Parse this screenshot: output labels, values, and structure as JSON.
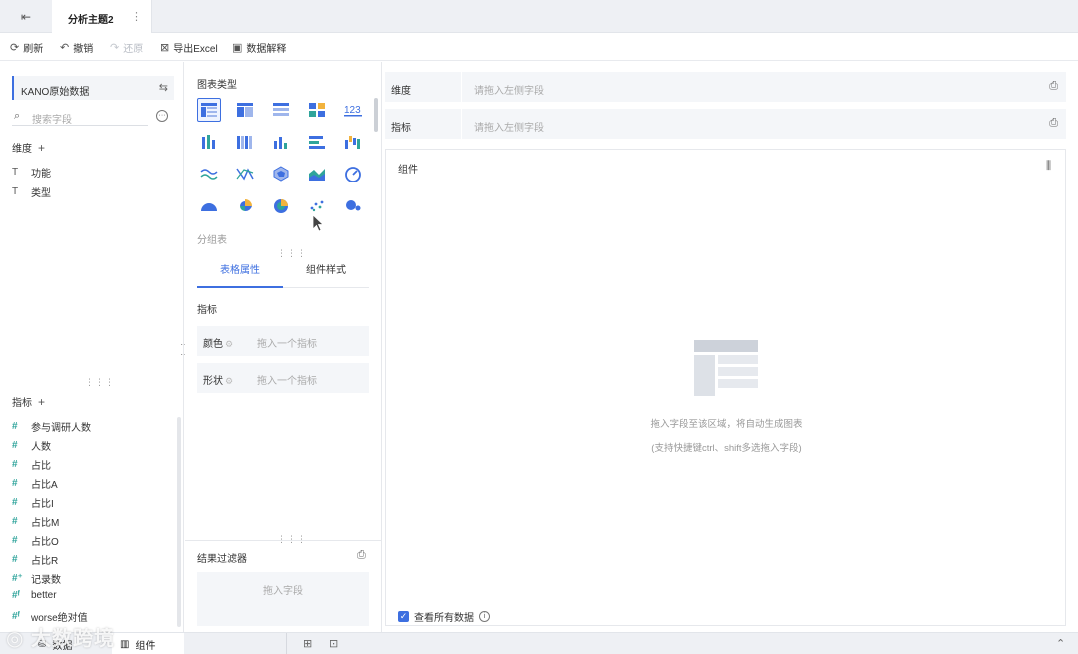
{
  "tabbar": {
    "back_icon": "exit-icon",
    "tab_title": "分析主题2",
    "more_icon": "more-vertical-icon"
  },
  "toolbar": {
    "refresh": "刷新",
    "undo": "撤销",
    "redo": "还原",
    "export": "导出Excel",
    "explain": "数据解释"
  },
  "left": {
    "dataset": "KANO原始数据",
    "search_placeholder": "搜索字段",
    "dimensions_title": "维度",
    "dimensions": [
      "功能",
      "类型"
    ],
    "measures_title": "指标",
    "measures": [
      "参与调研人数",
      "人数",
      "占比",
      "占比A",
      "占比I",
      "占比M",
      "占比O",
      "占比R",
      "记录数",
      "better",
      "worse绝对值"
    ]
  },
  "middle": {
    "chart_type_title": "图表类型",
    "chart_type_name": "分组表",
    "tab_properties": "表格属性",
    "tab_style": "组件样式",
    "section_measure": "指标",
    "color_label": "颜色",
    "color_placeholder": "拖入一个指标",
    "shape_label": "形状",
    "shape_placeholder": "拖入一个指标",
    "filter_title": "结果过滤器",
    "filter_placeholder": "拖入字段"
  },
  "right": {
    "dimension_label": "维度",
    "dimension_placeholder": "请拖入左侧字段",
    "measure_label": "指标",
    "measure_placeholder": "请拖入左侧字段",
    "component_title": "组件",
    "hint_main": "拖入字段至该区域，将自动生成图表",
    "hint_sub": "(支持快捷键ctrl、shift多选拖入字段)",
    "view_all": "查看所有数据"
  },
  "bottom": {
    "data_tab": "数据",
    "component_tab": "组件"
  },
  "watermark": "大数跨境",
  "colors": {
    "accent": "#3d6fe0",
    "measure_icon": "#2fa49b",
    "panel_bg": "#f4f6f9"
  }
}
